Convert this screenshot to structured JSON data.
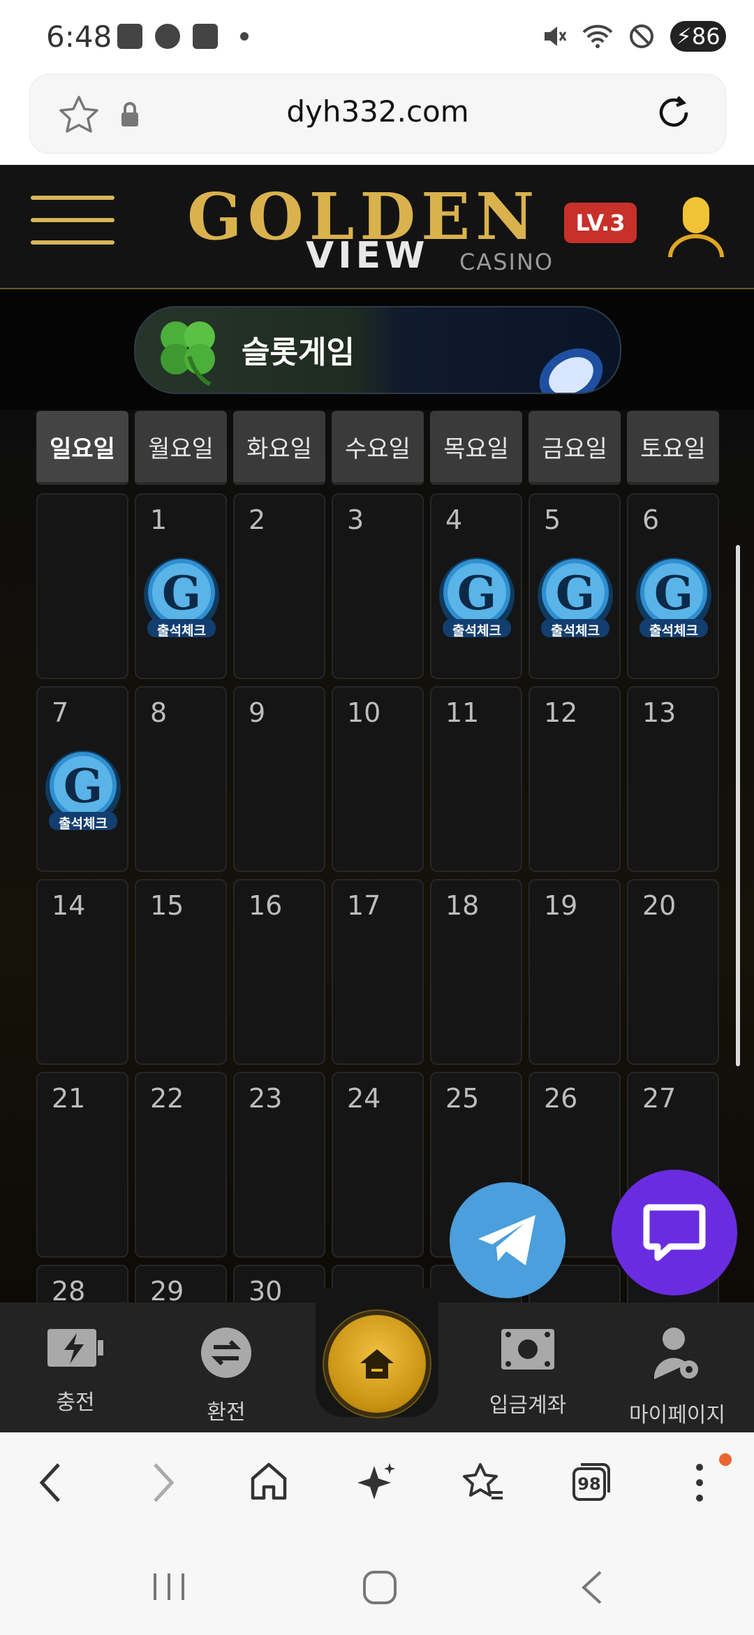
{
  "status_bar": {
    "time": "6:48",
    "battery": "86"
  },
  "browser": {
    "url": "dyh332.com",
    "tab_count": "98"
  },
  "header": {
    "level_badge": "LV.3",
    "logo_word1": "GOLDEN",
    "logo_word2": "VIEW",
    "logo_word3": "CASINO"
  },
  "banner": {
    "label": "슬롯게임"
  },
  "calendar": {
    "weekdays": [
      "일요일",
      "월요일",
      "화요일",
      "수요일",
      "목요일",
      "금요일",
      "토요일"
    ],
    "stamp_label": "출석체크",
    "days": [
      {
        "n": "",
        "s": false
      },
      {
        "n": "1",
        "s": true
      },
      {
        "n": "2",
        "s": false
      },
      {
        "n": "3",
        "s": false
      },
      {
        "n": "4",
        "s": true
      },
      {
        "n": "5",
        "s": true
      },
      {
        "n": "6",
        "s": true
      },
      {
        "n": "7",
        "s": true
      },
      {
        "n": "8",
        "s": false
      },
      {
        "n": "9",
        "s": false
      },
      {
        "n": "10",
        "s": false
      },
      {
        "n": "11",
        "s": false
      },
      {
        "n": "12",
        "s": false
      },
      {
        "n": "13",
        "s": false
      },
      {
        "n": "14",
        "s": false
      },
      {
        "n": "15",
        "s": false
      },
      {
        "n": "16",
        "s": false
      },
      {
        "n": "17",
        "s": false
      },
      {
        "n": "18",
        "s": false
      },
      {
        "n": "19",
        "s": false
      },
      {
        "n": "20",
        "s": false
      },
      {
        "n": "21",
        "s": false
      },
      {
        "n": "22",
        "s": false
      },
      {
        "n": "23",
        "s": false
      },
      {
        "n": "24",
        "s": false
      },
      {
        "n": "25",
        "s": false
      },
      {
        "n": "26",
        "s": false
      },
      {
        "n": "27",
        "s": false
      },
      {
        "n": "28",
        "s": false
      },
      {
        "n": "29",
        "s": false
      },
      {
        "n": "30",
        "s": false
      },
      {
        "n": "",
        "s": false
      },
      {
        "n": "",
        "s": false
      },
      {
        "n": "",
        "s": false
      },
      {
        "n": "",
        "s": false
      }
    ]
  },
  "bottom_nav": {
    "charge": "충전",
    "exchange": "환전",
    "deposit_account": "입금계좌",
    "mypage": "마이페이지"
  }
}
